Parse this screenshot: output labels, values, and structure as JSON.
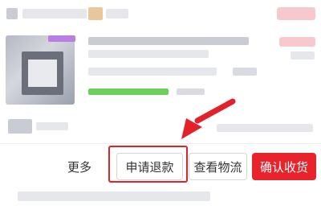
{
  "actions": {
    "more_label": "更多",
    "refund_label": "申请退款",
    "logistics_label": "查看物流",
    "confirm_label": "确认收货"
  },
  "colors": {
    "accent_red": "#e8232c",
    "annotation_red": "#e3212b"
  },
  "icons": {
    "annotation": "arrow-pointer-icon"
  }
}
